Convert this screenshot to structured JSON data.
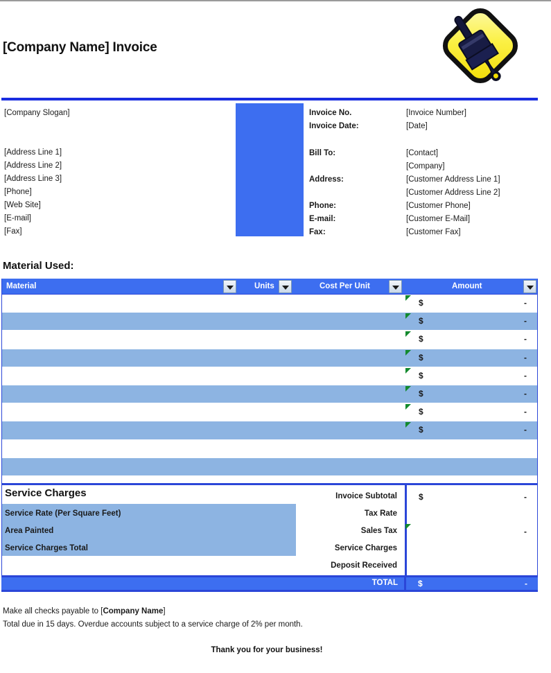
{
  "header": {
    "title": "[Company Name] Invoice",
    "logo_icon": "paintbrush-diamond-logo"
  },
  "company": {
    "slogan": "[Company Slogan]",
    "address_line_1": "[Address Line 1]",
    "address_line_2": "[Address Line 2]",
    "address_line_3": "[Address Line 3]",
    "phone": "[Phone]",
    "website": "[Web Site]",
    "email": "[E-mail]",
    "fax": "[Fax]"
  },
  "invoice_meta": {
    "invoice_no_label": "Invoice No.",
    "invoice_no_value": "[Invoice Number]",
    "invoice_date_label": "Invoice Date:",
    "invoice_date_value": "[Date]"
  },
  "bill_to": {
    "bill_to_label": "Bill To:",
    "contact_value": "[Contact]",
    "company_value": "[Company]",
    "address_label": "Address:",
    "address_line_1_value": "[Customer Address Line 1]",
    "address_line_2_value": "[Customer Address Line 2]",
    "phone_label": "Phone:",
    "phone_value": "[Customer Phone]",
    "email_label": "E-mail:",
    "email_value": "[Customer E-Mail]",
    "fax_label": "Fax:",
    "fax_value": "[Customer Fax]"
  },
  "material_section": {
    "heading": "Material Used:",
    "columns": [
      {
        "label": "Material",
        "has_filter": true
      },
      {
        "label": "Units",
        "has_filter": true
      },
      {
        "label": "Cost Per Unit",
        "has_filter": true
      },
      {
        "label": "Amount",
        "has_filter": true
      }
    ],
    "rows": [
      {
        "material": "",
        "units": "",
        "cost_per_unit": "",
        "currency": "$",
        "amount": "-",
        "shaded": false,
        "flag": true
      },
      {
        "material": "",
        "units": "",
        "cost_per_unit": "",
        "currency": "$",
        "amount": "-",
        "shaded": true,
        "flag": true
      },
      {
        "material": "",
        "units": "",
        "cost_per_unit": "",
        "currency": "$",
        "amount": "-",
        "shaded": false,
        "flag": true
      },
      {
        "material": "",
        "units": "",
        "cost_per_unit": "",
        "currency": "$",
        "amount": "-",
        "shaded": true,
        "flag": true
      },
      {
        "material": "",
        "units": "",
        "cost_per_unit": "",
        "currency": "$",
        "amount": "-",
        "shaded": false,
        "flag": true
      },
      {
        "material": "",
        "units": "",
        "cost_per_unit": "",
        "currency": "$",
        "amount": "-",
        "shaded": true,
        "flag": true
      },
      {
        "material": "",
        "units": "",
        "cost_per_unit": "",
        "currency": "$",
        "amount": "-",
        "shaded": false,
        "flag": true
      },
      {
        "material": "",
        "units": "",
        "cost_per_unit": "",
        "currency": "$",
        "amount": "-",
        "shaded": true,
        "flag": true
      },
      {
        "material": "",
        "units": "",
        "cost_per_unit": "",
        "currency": "",
        "amount": "",
        "shaded": false,
        "flag": false
      },
      {
        "material": "",
        "units": "",
        "cost_per_unit": "",
        "currency": "",
        "amount": "",
        "shaded": true,
        "flag": false
      },
      {
        "material": "",
        "units": "",
        "cost_per_unit": "",
        "currency": "",
        "amount": "",
        "shaded": false,
        "flag": false
      }
    ]
  },
  "service_charges": {
    "heading": "Service Charges",
    "items": [
      {
        "label": "Service Rate (Per Square Feet)",
        "value": ""
      },
      {
        "label": "Area Painted",
        "value": ""
      },
      {
        "label": "Service Charges Total",
        "value": ""
      }
    ]
  },
  "totals": {
    "rows": [
      {
        "label": "Invoice Subtotal",
        "currency": "$",
        "value": "-",
        "flag": false
      },
      {
        "label": "Tax Rate",
        "currency": "",
        "value": "",
        "flag": false
      },
      {
        "label": "Sales Tax",
        "currency": "",
        "value": "-",
        "flag": true
      },
      {
        "label": "Service Charges",
        "currency": "",
        "value": "",
        "flag": false
      },
      {
        "label": "Deposit Received",
        "currency": "",
        "value": "",
        "flag": false
      }
    ],
    "total_label": "TOTAL",
    "total_currency": "$",
    "total_value": "-"
  },
  "footer": {
    "payable_prefix": "Make all checks payable to [",
    "payable_company": "Company Name",
    "payable_suffix": "]",
    "terms": "Total due in 15 days. Overdue accounts subject to a service charge of 2% per month.",
    "thanks": "Thank you for your business!"
  },
  "colors": {
    "accent_blue": "#3d6ef0",
    "border_blue": "#2b46d8",
    "band_blue": "#8db4e2",
    "logo_yellow": "#f7ec1e",
    "flag_green": "#138a2e"
  }
}
